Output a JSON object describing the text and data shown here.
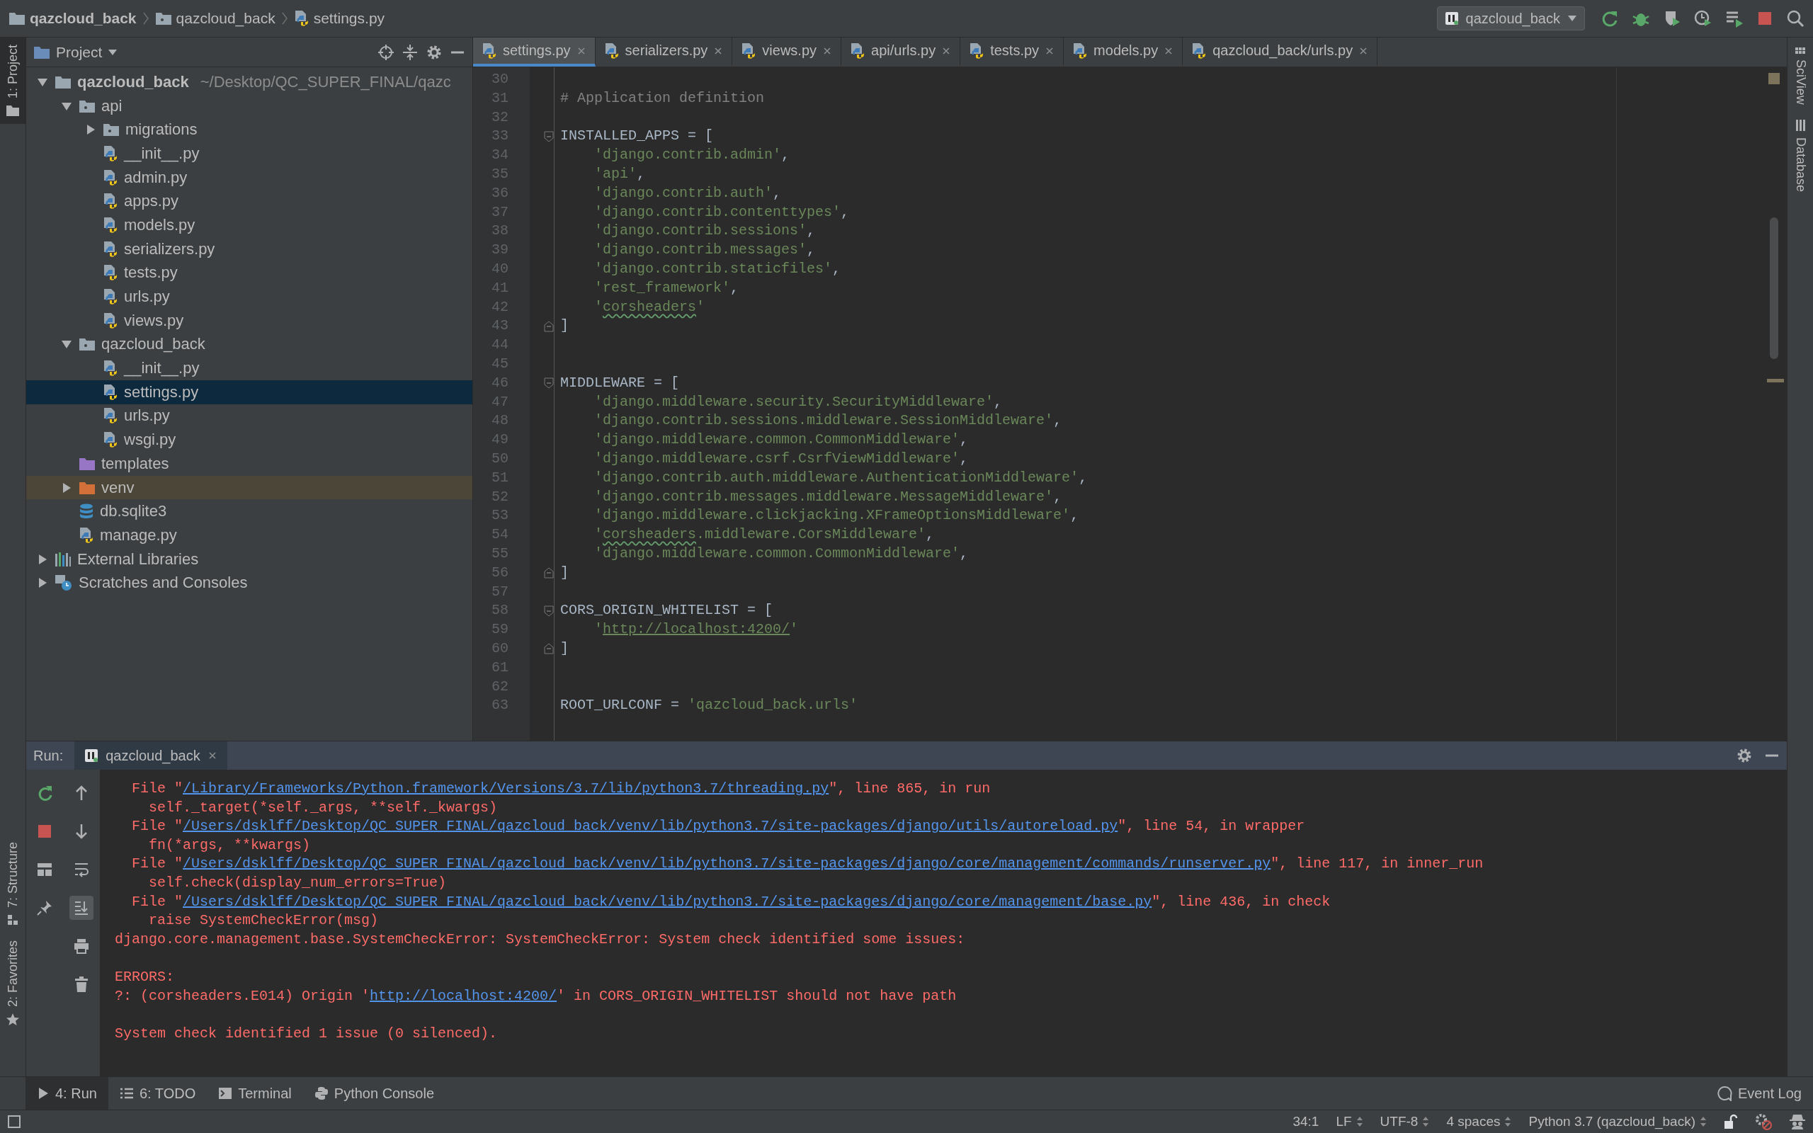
{
  "breadcrumbs": [
    {
      "label": "qazcloud_back",
      "kind": "root"
    },
    {
      "label": "qazcloud_back",
      "kind": "folder"
    },
    {
      "label": "settings.py",
      "kind": "file"
    }
  ],
  "run_config": {
    "label": "qazcloud_back"
  },
  "left_strip": [
    {
      "label": "1: Project",
      "selected": true
    },
    {
      "label": "7: Structure",
      "selected": false
    },
    {
      "label": "2: Favorites",
      "selected": false
    }
  ],
  "right_strip": [
    {
      "label": "SciView",
      "selected": false
    },
    {
      "label": "Database",
      "selected": false
    }
  ],
  "project": {
    "title": "Project",
    "tree": [
      {
        "name": "qazcloud_back",
        "hint": "~/Desktop/QC_SUPER_FINAL/qazc",
        "kind": "root",
        "expanded": true,
        "selected": false,
        "children": [
          {
            "name": "api",
            "kind": "module",
            "expanded": true,
            "selected": false,
            "children": [
              {
                "name": "migrations",
                "kind": "module",
                "expanded": false,
                "selected": false
              },
              {
                "name": "__init__.py",
                "kind": "python",
                "selected": false
              },
              {
                "name": "admin.py",
                "kind": "python",
                "selected": false
              },
              {
                "name": "apps.py",
                "kind": "python",
                "selected": false
              },
              {
                "name": "models.py",
                "kind": "python",
                "selected": false
              },
              {
                "name": "serializers.py",
                "kind": "python",
                "selected": false
              },
              {
                "name": "tests.py",
                "kind": "python",
                "selected": false
              },
              {
                "name": "urls.py",
                "kind": "python",
                "selected": false
              },
              {
                "name": "views.py",
                "kind": "python",
                "selected": false
              }
            ]
          },
          {
            "name": "qazcloud_back",
            "kind": "module",
            "expanded": true,
            "selected": false,
            "children": [
              {
                "name": "__init__.py",
                "kind": "python",
                "selected": false
              },
              {
                "name": "settings.py",
                "kind": "python",
                "selected": true
              },
              {
                "name": "urls.py",
                "kind": "python",
                "selected": false
              },
              {
                "name": "wsgi.py",
                "kind": "python",
                "selected": false
              }
            ]
          },
          {
            "name": "templates",
            "kind": "templates",
            "selected": false
          },
          {
            "name": "venv",
            "kind": "excluded",
            "expanded": false,
            "selected": false
          },
          {
            "name": "db.sqlite3",
            "kind": "database",
            "selected": false
          },
          {
            "name": "manage.py",
            "kind": "python",
            "selected": false
          }
        ]
      },
      {
        "name": "External Libraries",
        "kind": "libraries",
        "expanded": false,
        "selected": false
      },
      {
        "name": "Scratches and Consoles",
        "kind": "scratches",
        "expanded": false,
        "selected": false
      }
    ]
  },
  "tabs": [
    {
      "label": "settings.py",
      "selected": true
    },
    {
      "label": "serializers.py",
      "selected": false
    },
    {
      "label": "views.py",
      "selected": false
    },
    {
      "label": "api/urls.py",
      "selected": false
    },
    {
      "label": "tests.py",
      "selected": false
    },
    {
      "label": "models.py",
      "selected": false
    },
    {
      "label": "qazcloud_back/urls.py",
      "selected": false
    }
  ],
  "code": [
    {
      "number": "30",
      "kind": "plain"
    },
    {
      "number": "31",
      "kind": "plain",
      "segments": [
        {
          "kind": "comment",
          "text": "# Application definition"
        }
      ]
    },
    {
      "number": "32",
      "kind": "plain"
    },
    {
      "number": "33",
      "kind": "fold-start",
      "segments": [
        {
          "kind": "plain",
          "text": "INSTALLED_APPS = ["
        }
      ]
    },
    {
      "number": "34",
      "kind": "plain",
      "segments": [
        {
          "kind": "string",
          "text": "    'django.contrib.admin'"
        },
        {
          "kind": "plain",
          "text": ","
        }
      ]
    },
    {
      "number": "35",
      "kind": "plain",
      "segments": [
        {
          "kind": "string",
          "text": "    'api'"
        },
        {
          "kind": "plain",
          "text": ","
        }
      ]
    },
    {
      "number": "36",
      "kind": "plain",
      "segments": [
        {
          "kind": "string",
          "text": "    'django.contrib.auth'"
        },
        {
          "kind": "plain",
          "text": ","
        }
      ]
    },
    {
      "number": "37",
      "kind": "plain",
      "segments": [
        {
          "kind": "string",
          "text": "    'django.contrib.contenttypes'"
        },
        {
          "kind": "plain",
          "text": ","
        }
      ]
    },
    {
      "number": "38",
      "kind": "plain",
      "segments": [
        {
          "kind": "string",
          "text": "    'django.contrib.sessions'"
        },
        {
          "kind": "plain",
          "text": ","
        }
      ]
    },
    {
      "number": "39",
      "kind": "plain",
      "segments": [
        {
          "kind": "string",
          "text": "    'django.contrib.messages'"
        },
        {
          "kind": "plain",
          "text": ","
        }
      ]
    },
    {
      "number": "40",
      "kind": "plain",
      "segments": [
        {
          "kind": "string",
          "text": "    'django.contrib.staticfiles'"
        },
        {
          "kind": "plain",
          "text": ","
        }
      ]
    },
    {
      "number": "41",
      "kind": "plain",
      "segments": [
        {
          "kind": "string",
          "text": "    'rest_framework'"
        },
        {
          "kind": "plain",
          "text": ","
        }
      ]
    },
    {
      "number": "42",
      "kind": "plain",
      "segments": [
        {
          "kind": "string",
          "text": "    '"
        },
        {
          "kind": "typo",
          "text": "corsheaders"
        },
        {
          "kind": "string",
          "text": "'"
        }
      ]
    },
    {
      "number": "43",
      "kind": "fold-end",
      "segments": [
        {
          "kind": "plain",
          "text": "]"
        }
      ]
    },
    {
      "number": "44",
      "kind": "plain"
    },
    {
      "number": "45",
      "kind": "plain"
    },
    {
      "number": "46",
      "kind": "fold-start",
      "segments": [
        {
          "kind": "plain",
          "text": "MIDDLEWARE = ["
        }
      ]
    },
    {
      "number": "47",
      "kind": "plain",
      "segments": [
        {
          "kind": "string",
          "text": "    'django.middleware.security.SecurityMiddleware'"
        },
        {
          "kind": "plain",
          "text": ","
        }
      ]
    },
    {
      "number": "48",
      "kind": "plain",
      "segments": [
        {
          "kind": "string",
          "text": "    'django.contrib.sessions.middleware.SessionMiddleware'"
        },
        {
          "kind": "plain",
          "text": ","
        }
      ]
    },
    {
      "number": "49",
      "kind": "plain",
      "segments": [
        {
          "kind": "string",
          "text": "    'django.middleware.common.CommonMiddleware'"
        },
        {
          "kind": "plain",
          "text": ","
        }
      ]
    },
    {
      "number": "50",
      "kind": "plain",
      "segments": [
        {
          "kind": "string",
          "text": "    'django.middleware.csrf.CsrfViewMiddleware'"
        },
        {
          "kind": "plain",
          "text": ","
        }
      ]
    },
    {
      "number": "51",
      "kind": "plain",
      "segments": [
        {
          "kind": "string",
          "text": "    'django.contrib.auth.middleware.AuthenticationMiddleware'"
        },
        {
          "kind": "plain",
          "text": ","
        }
      ]
    },
    {
      "number": "52",
      "kind": "plain",
      "segments": [
        {
          "kind": "string",
          "text": "    'django.contrib.messages.middleware.MessageMiddleware'"
        },
        {
          "kind": "plain",
          "text": ","
        }
      ]
    },
    {
      "number": "53",
      "kind": "plain",
      "segments": [
        {
          "kind": "string",
          "text": "    'django.middleware.clickjacking.XFrameOptionsMiddleware'"
        },
        {
          "kind": "plain",
          "text": ","
        }
      ]
    },
    {
      "number": "54",
      "kind": "plain",
      "segments": [
        {
          "kind": "string",
          "text": "    '"
        },
        {
          "kind": "typo",
          "text": "corsheaders"
        },
        {
          "kind": "string",
          "text": ".middleware.CorsMiddleware'"
        },
        {
          "kind": "plain",
          "text": ","
        }
      ]
    },
    {
      "number": "55",
      "kind": "plain",
      "segments": [
        {
          "kind": "string",
          "text": "    'django.middleware.common.CommonMiddleware'"
        },
        {
          "kind": "plain",
          "text": ","
        }
      ]
    },
    {
      "number": "56",
      "kind": "fold-end",
      "segments": [
        {
          "kind": "plain",
          "text": "]"
        }
      ]
    },
    {
      "number": "57",
      "kind": "plain"
    },
    {
      "number": "58",
      "kind": "fold-start",
      "segments": [
        {
          "kind": "plain",
          "text": "CORS_ORIGIN_WHITELIST = ["
        }
      ]
    },
    {
      "number": "59",
      "kind": "plain",
      "segments": [
        {
          "kind": "string",
          "text": "    '"
        },
        {
          "kind": "link",
          "text": "http://localhost:4200/"
        },
        {
          "kind": "string",
          "text": "'"
        }
      ]
    },
    {
      "number": "60",
      "kind": "fold-end",
      "segments": [
        {
          "kind": "plain",
          "text": "]"
        }
      ]
    },
    {
      "number": "61",
      "kind": "plain"
    },
    {
      "number": "62",
      "kind": "plain"
    },
    {
      "number": "63",
      "kind": "plain",
      "segments": [
        {
          "kind": "plain",
          "text": "ROOT_URLCONF = "
        },
        {
          "kind": "string",
          "text": "'qazcloud_back.urls'"
        }
      ]
    }
  ],
  "run_panel": {
    "label": "Run:",
    "tab": "qazcloud_back",
    "scroll_to_end_active": true,
    "lines": [
      {
        "kind": "text",
        "segments": [
          {
            "kind": "error",
            "text": "  File \""
          },
          {
            "kind": "link",
            "text": "/Library/Frameworks/Python.framework/Versions/3.7/lib/python3.7/threading.py"
          },
          {
            "kind": "error",
            "text": "\", line 865, in run"
          }
        ]
      },
      {
        "kind": "text",
        "segments": [
          {
            "kind": "error",
            "text": "    self._target(*self._args, **self._kwargs)"
          }
        ]
      },
      {
        "kind": "text",
        "segments": [
          {
            "kind": "error",
            "text": "  File \""
          },
          {
            "kind": "link",
            "text": "/Users/dsklff/Desktop/QC_SUPER_FINAL/qazcloud_back/venv/lib/python3.7/site-packages/django/utils/autoreload.py"
          },
          {
            "kind": "error",
            "text": "\", line 54, in wrapper"
          }
        ]
      },
      {
        "kind": "text",
        "segments": [
          {
            "kind": "error",
            "text": "    fn(*args, **kwargs)"
          }
        ]
      },
      {
        "kind": "text",
        "segments": [
          {
            "kind": "error",
            "text": "  File \""
          },
          {
            "kind": "link",
            "text": "/Users/dsklff/Desktop/QC_SUPER_FINAL/qazcloud_back/venv/lib/python3.7/site-packages/django/core/management/commands/runserver.py"
          },
          {
            "kind": "error",
            "text": "\", line 117, in inner_run"
          }
        ]
      },
      {
        "kind": "text",
        "segments": [
          {
            "kind": "error",
            "text": "    self.check(display_num_errors=True)"
          }
        ]
      },
      {
        "kind": "text",
        "segments": [
          {
            "kind": "error",
            "text": "  File \""
          },
          {
            "kind": "link",
            "text": "/Users/dsklff/Desktop/QC_SUPER_FINAL/qazcloud_back/venv/lib/python3.7/site-packages/django/core/management/base.py"
          },
          {
            "kind": "error",
            "text": "\", line 436, in check"
          }
        ]
      },
      {
        "kind": "text",
        "segments": [
          {
            "kind": "error",
            "text": "    raise SystemCheckError(msg)"
          }
        ]
      },
      {
        "kind": "text",
        "segments": [
          {
            "kind": "error",
            "text": "django.core.management.base.SystemCheckError: SystemCheckError: System check identified some issues:"
          }
        ]
      },
      {
        "kind": "blank"
      },
      {
        "kind": "text",
        "segments": [
          {
            "kind": "error",
            "text": "ERRORS:"
          }
        ]
      },
      {
        "kind": "text",
        "segments": [
          {
            "kind": "error",
            "text": "?: (corsheaders.E014) Origin '"
          },
          {
            "kind": "link",
            "text": "http://localhost:4200/"
          },
          {
            "kind": "error",
            "text": "' in CORS_ORIGIN_WHITELIST should not have path"
          }
        ]
      },
      {
        "kind": "blank"
      },
      {
        "kind": "text",
        "segments": [
          {
            "kind": "error",
            "text": "System check identified 1 issue (0 silenced)."
          }
        ]
      }
    ]
  },
  "tool_tabs": [
    {
      "label": "4: Run",
      "kind": "run",
      "selected": true
    },
    {
      "label": "6: TODO",
      "kind": "todo",
      "selected": false
    },
    {
      "label": "Terminal",
      "kind": "terminal",
      "selected": false
    },
    {
      "label": "Python Console",
      "kind": "console",
      "selected": false
    }
  ],
  "event_log": "Event Log",
  "status_bar": {
    "position": "34:1",
    "line_separator": "LF",
    "encoding": "UTF-8",
    "indent": "4 spaces",
    "interpreter": "Python 3.7 (qazcloud_back)"
  }
}
